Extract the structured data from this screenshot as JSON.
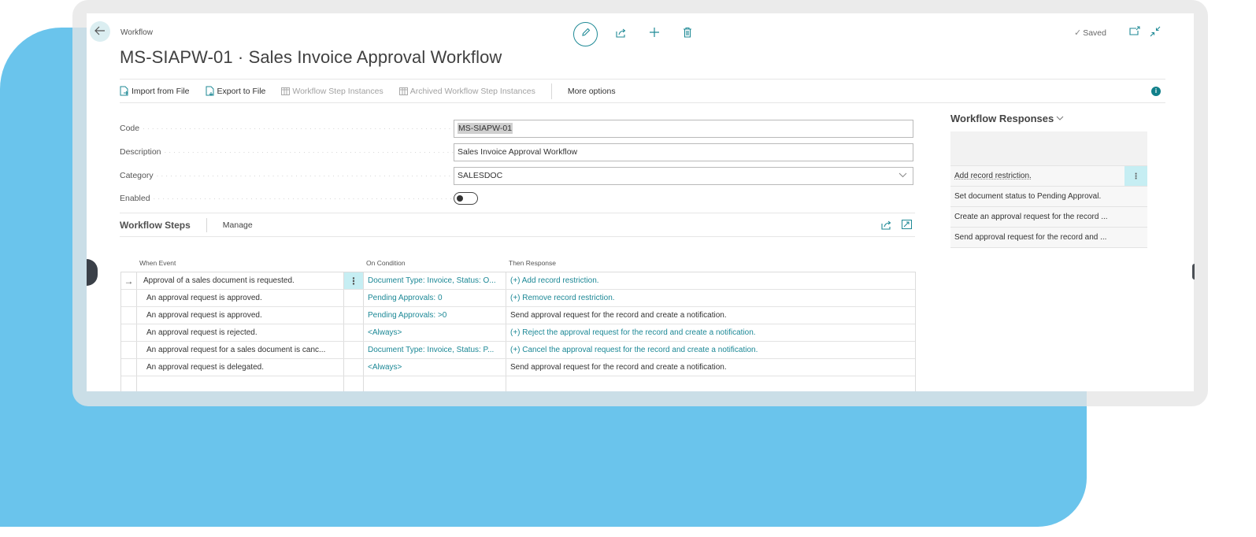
{
  "header": {
    "breadcrumb": "Workflow",
    "title": "MS-SIAPW-01 · Sales Invoice Approval Workflow",
    "saved_label": "Saved",
    "icons": [
      "back-arrow-icon",
      "edit-pencil-icon",
      "share-icon",
      "add-icon",
      "delete-icon",
      "open-new-window-icon",
      "collapse-icon"
    ]
  },
  "actionbar": {
    "items": [
      {
        "label": "Import from File",
        "enabled": true,
        "icon": "import-file-icon"
      },
      {
        "label": "Export to File",
        "enabled": true,
        "icon": "export-file-icon"
      },
      {
        "label": "Workflow Step Instances",
        "enabled": false,
        "icon": "table-icon"
      },
      {
        "label": "Archived Workflow Step Instances",
        "enabled": false,
        "icon": "table-icon"
      }
    ],
    "more_options": "More options",
    "info_label": "i"
  },
  "fields": {
    "code": {
      "label": "Code",
      "value": "MS-SIAPW-01"
    },
    "description": {
      "label": "Description",
      "value": "Sales Invoice Approval Workflow"
    },
    "category": {
      "label": "Category",
      "value": "SALESDOC"
    },
    "enabled": {
      "label": "Enabled",
      "value": false
    }
  },
  "steps": {
    "title": "Workflow Steps",
    "manage": "Manage",
    "columns": {
      "event": "When Event",
      "condition": "On Condition",
      "response": "Then Response"
    },
    "rows": [
      {
        "event": "Approval of a sales document is requested.",
        "condition": "Document Type: Invoice, Status: O...",
        "response": "(+) Add record restriction.",
        "response_link": true,
        "selected": true
      },
      {
        "event": "An approval request is approved.",
        "condition": "Pending Approvals: 0",
        "response": "(+) Remove record restriction.",
        "response_link": true,
        "selected": false
      },
      {
        "event": "An approval request is approved.",
        "condition": "Pending Approvals: >0",
        "response": "Send approval request for the record and create a notification.",
        "response_link": false,
        "selected": false
      },
      {
        "event": "An approval request is rejected.",
        "condition": "<Always>",
        "response": "(+) Reject the approval request for the record and create a notification.",
        "response_link": true,
        "selected": false
      },
      {
        "event": "An approval request for a sales document is canc...",
        "condition": "Document Type: Invoice, Status: P...",
        "response": "(+) Cancel the approval request for the record and create a notification.",
        "response_link": true,
        "selected": false
      },
      {
        "event": "An approval request is delegated.",
        "condition": "<Always>",
        "response": "Send approval request for the record and create a notification.",
        "response_link": false,
        "selected": false
      },
      {
        "event": "",
        "condition": "",
        "response": "",
        "response_link": false,
        "selected": false
      }
    ],
    "selected_marker": "→",
    "menu_glyph": "⋮"
  },
  "responses": {
    "title": "Workflow Responses",
    "items": [
      "Add record restriction.",
      "Set document status to Pending Approval.",
      "Create an approval request for the record ...",
      "Send approval request for the record and ..."
    ]
  },
  "colors": {
    "accent": "#1c8896",
    "background_blue": "#6ac4ec",
    "selected_cell": "#c6eef3"
  }
}
